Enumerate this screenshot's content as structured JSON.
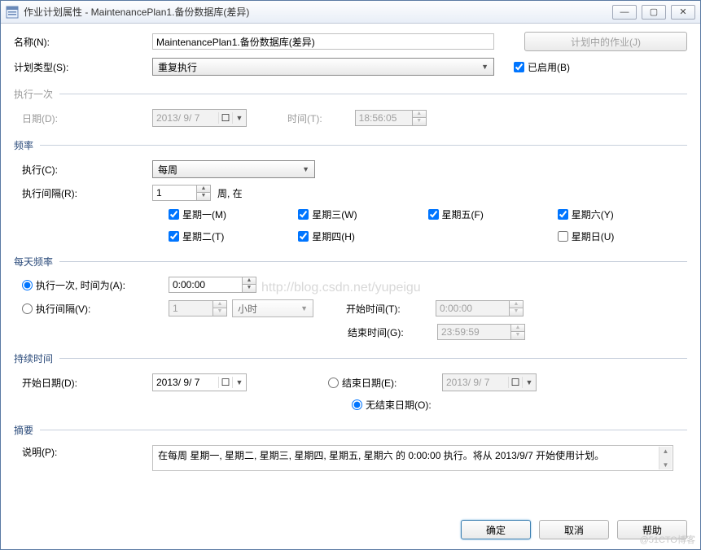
{
  "window": {
    "title": "作业计划属性 - MaintenancePlan1.备份数据库(差异)",
    "minimize": "—",
    "maximize": "▢",
    "close": "✕"
  },
  "labels": {
    "name": "名称(N):",
    "schedule_type": "计划类型(S):",
    "enabled": "已启用(B)",
    "jobs_in_plan": "计划中的作业(J)",
    "one_time": "执行一次",
    "date": "日期(D):",
    "time": "时间(T):",
    "frequency": "频率",
    "occurs": "执行(C):",
    "interval": "执行间隔(R):",
    "week_on": "周, 在",
    "mon": "星期一(M)",
    "tue": "星期二(T)",
    "wed": "星期三(W)",
    "thu": "星期四(H)",
    "fri": "星期五(F)",
    "sat": "星期六(Y)",
    "sun": "星期日(U)",
    "daily_freq": "每天频率",
    "once_at": "执行一次, 时间为(A):",
    "occurs_every": "执行间隔(V):",
    "unit_hour": "小时",
    "start_time": "开始时间(T):",
    "end_time": "结束时间(G):",
    "duration": "持续时间",
    "start_date": "开始日期(D):",
    "end_date": "结束日期(E):",
    "no_end_date": "无结束日期(O):",
    "summary": "摘要",
    "description": "说明(P):"
  },
  "values": {
    "name": "MaintenancePlan1.备份数据库(差异)",
    "schedule_type": "重复执行",
    "enabled": true,
    "onetime_date": "2013/ 9/ 7",
    "onetime_time": "18:56:05",
    "occurs": "每周",
    "recurs_every": "1",
    "days": {
      "mon": true,
      "tue": true,
      "wed": true,
      "thu": true,
      "fri": true,
      "sat": true,
      "sun": false
    },
    "daily_mode": "once",
    "once_at": "0:00:00",
    "every_n": "1",
    "every_unit": "小时",
    "start_time": "0:00:00",
    "end_time": "23:59:59",
    "start_date": "2013/ 9/ 7",
    "end_date": "2013/ 9/ 7",
    "end_mode": "no_end",
    "description": "在每周 星期一, 星期二, 星期三, 星期四, 星期五, 星期六 的 0:00:00 执行。将从 2013/9/7 开始使用计划。"
  },
  "buttons": {
    "ok": "确定",
    "cancel": "取消",
    "help": "帮助"
  },
  "watermark": "http://blog.csdn.net/yupeigu",
  "corner": "@51CTO博客"
}
